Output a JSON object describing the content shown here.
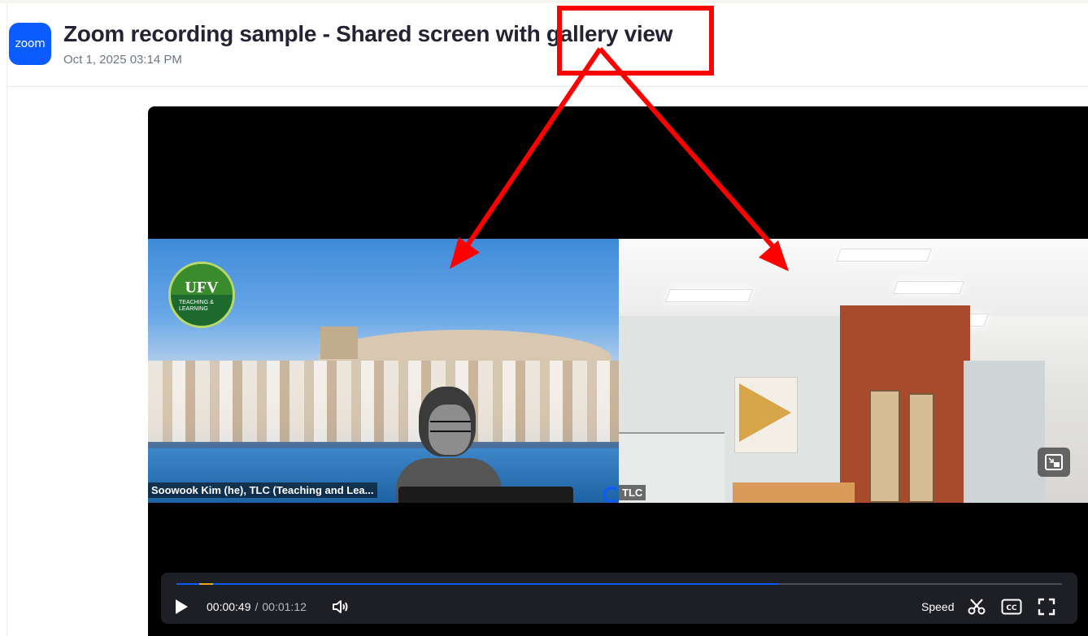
{
  "header": {
    "logo_text": "zoom",
    "title": "Zoom recording sample - Shared screen with gallery view",
    "date": "Oct 1, 2025 03:14 PM"
  },
  "video": {
    "left_tile": {
      "name": "Soowook Kim (he), TLC (Teaching and Lea...",
      "logo_main": "UFV",
      "logo_sub_1": "TEACHING &",
      "logo_sub_2": "LEARNING"
    },
    "right_tile": {
      "name": "TLC"
    }
  },
  "controls": {
    "current_time": "00:00:49",
    "separator": "/",
    "total_time": "00:01:12",
    "speed_label": "Speed",
    "progress_fraction": 0.68
  },
  "colors": {
    "brand": "#0b5cff",
    "annotation": "#ff0000",
    "played": "#f4a51c"
  }
}
